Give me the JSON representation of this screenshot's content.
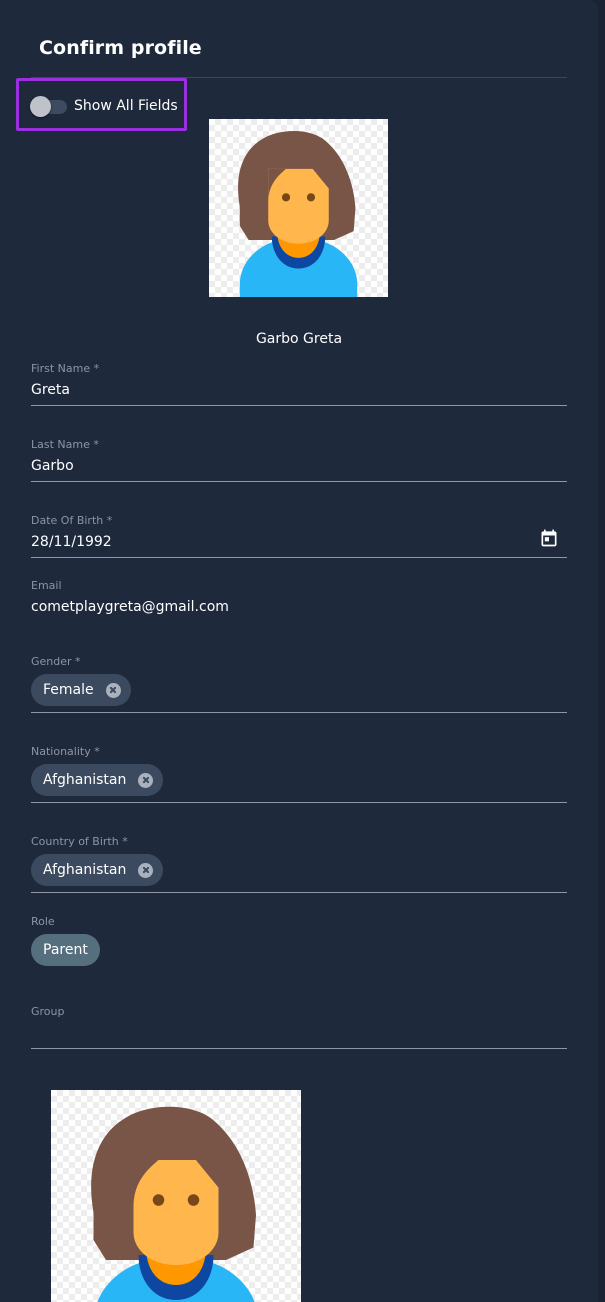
{
  "dialog": {
    "title": "Confirm profile"
  },
  "toggle": {
    "label": "Show All Fields",
    "checked": false
  },
  "profile": {
    "display_name": "Garbo Greta",
    "avatar_icon": "woman-avatar-icon"
  },
  "fields": {
    "first_name": {
      "label": "First Name *",
      "value": "Greta"
    },
    "last_name": {
      "label": "Last Name *",
      "value": "Garbo"
    },
    "date_of_birth": {
      "label": "Date Of Birth *",
      "value": "28/11/1992",
      "icon": "calendar-icon"
    },
    "email": {
      "label": "Email",
      "value": "cometplaygreta@gmail.com"
    },
    "gender": {
      "label": "Gender *",
      "chip": "Female"
    },
    "nationality": {
      "label": "Nationality *",
      "chip": "Afghanistan"
    },
    "country_of_birth": {
      "label": "Country of Birth *",
      "chip": "Afghanistan"
    },
    "role": {
      "label": "Role",
      "chip": "Parent"
    },
    "group": {
      "label": "Group",
      "value": ""
    }
  },
  "colors": {
    "background": "#1f293c",
    "highlight_border": "#9b30e0",
    "chip": "#3c4a60",
    "role_chip": "#566f7f",
    "label": "#8c95a6"
  }
}
